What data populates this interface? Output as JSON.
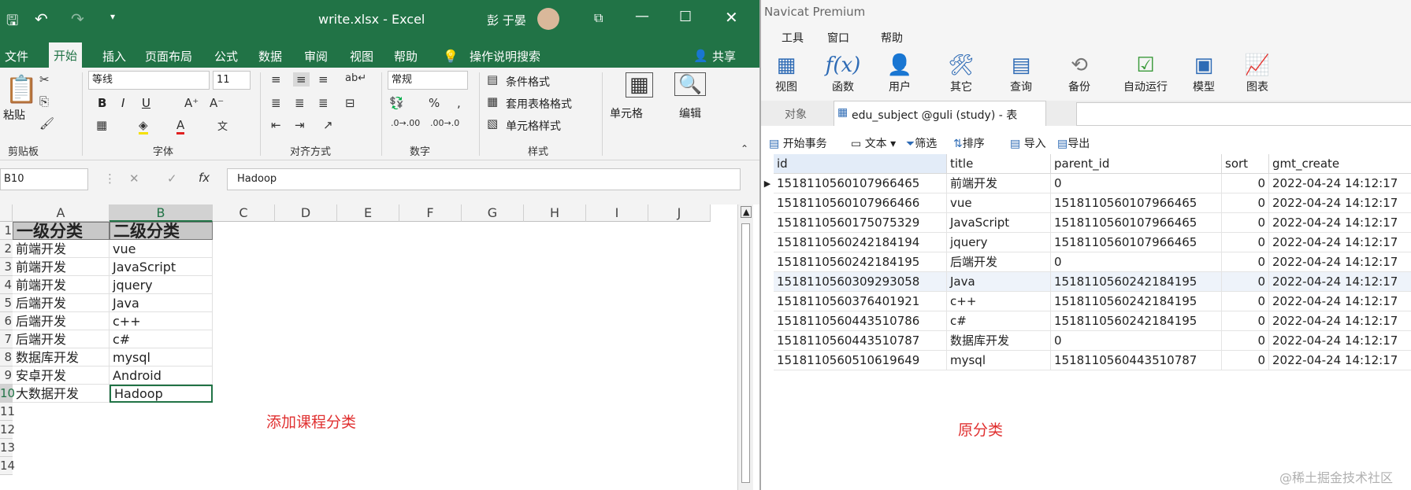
{
  "excel": {
    "window_title": "write.xlsx  -  Excel",
    "user_name": "彭 于晏",
    "tabs": [
      "文件",
      "开始",
      "插入",
      "页面布局",
      "公式",
      "数据",
      "审阅",
      "视图",
      "帮助"
    ],
    "tell_me": "操作说明搜索",
    "share": "共享",
    "ribbon": {
      "paste": "粘贴",
      "clipboard": "剪贴板",
      "font_name": "等线",
      "font_size": "11",
      "bold": "B",
      "italic": "I",
      "underline": "U",
      "font_group": "字体",
      "align_group": "对齐方式",
      "number_format": "常规",
      "number_group": "数字",
      "cond_format": "条件格式",
      "table_format": "套用表格格式",
      "cell_style": "单元格样式",
      "style_group": "样式",
      "cells": "单元格",
      "edit": "编辑"
    },
    "name_box": "B10",
    "formula": "Hadoop",
    "columns": [
      "A",
      "B",
      "C",
      "D",
      "E",
      "F",
      "G",
      "H",
      "I",
      "J"
    ],
    "rows": [
      "1",
      "2",
      "3",
      "4",
      "5",
      "6",
      "7",
      "8",
      "9",
      "10",
      "11",
      "12",
      "13",
      "14"
    ],
    "header_row": [
      "一级分类",
      "二级分类"
    ],
    "data_rows": [
      [
        "前端开发",
        "vue"
      ],
      [
        "前端开发",
        "JavaScript"
      ],
      [
        "前端开发",
        "jquery"
      ],
      [
        "后端开发",
        "Java"
      ],
      [
        "后端开发",
        "c++"
      ],
      [
        "后端开发",
        "c#"
      ],
      [
        "数据库开发",
        "mysql"
      ],
      [
        "安卓开发",
        "Android"
      ],
      [
        "大数据开发",
        "Hadoop"
      ]
    ],
    "annotation": "添加课程分类"
  },
  "navicat": {
    "title": "Navicat Premium",
    "menu": [
      "工具",
      "窗口",
      "帮助"
    ],
    "tools": [
      "视图",
      "函数",
      "用户",
      "其它",
      "查询",
      "备份",
      "自动运行",
      "模型",
      "图表"
    ],
    "object_tab": "对象",
    "table_tab": "edu_subject @guli (study) - 表",
    "actions": [
      "开始事务",
      "文本",
      "筛选",
      "排序",
      "导入",
      "导出"
    ],
    "columns": [
      "id",
      "title",
      "parent_id",
      "sort",
      "gmt_create"
    ],
    "rows": [
      [
        "1518110560107966465",
        "前端开发",
        "0",
        "0",
        "2022-04-24 14:12:17"
      ],
      [
        "1518110560107966466",
        "vue",
        "1518110560107966465",
        "0",
        "2022-04-24 14:12:17"
      ],
      [
        "1518110560175075329",
        "JavaScript",
        "1518110560107966465",
        "0",
        "2022-04-24 14:12:17"
      ],
      [
        "1518110560242184194",
        "jquery",
        "1518110560107966465",
        "0",
        "2022-04-24 14:12:17"
      ],
      [
        "1518110560242184195",
        "后端开发",
        "0",
        "0",
        "2022-04-24 14:12:17"
      ],
      [
        "1518110560309293058",
        "Java",
        "1518110560242184195",
        "0",
        "2022-04-24 14:12:17"
      ],
      [
        "1518110560376401921",
        "c++",
        "1518110560242184195",
        "0",
        "2022-04-24 14:12:17"
      ],
      [
        "1518110560443510786",
        "c#",
        "1518110560242184195",
        "0",
        "2022-04-24 14:12:17"
      ],
      [
        "1518110560443510787",
        "数据库开发",
        "0",
        "0",
        "2022-04-24 14:12:17"
      ],
      [
        "1518110560510619649",
        "mysql",
        "1518110560443510787",
        "0",
        "2022-04-24 14:12:17"
      ]
    ],
    "annotation": "原分类"
  },
  "watermark": "@稀土掘金技术社区",
  "colors": {
    "excel_green": "#217346",
    "annotation_red": "#e03030"
  }
}
